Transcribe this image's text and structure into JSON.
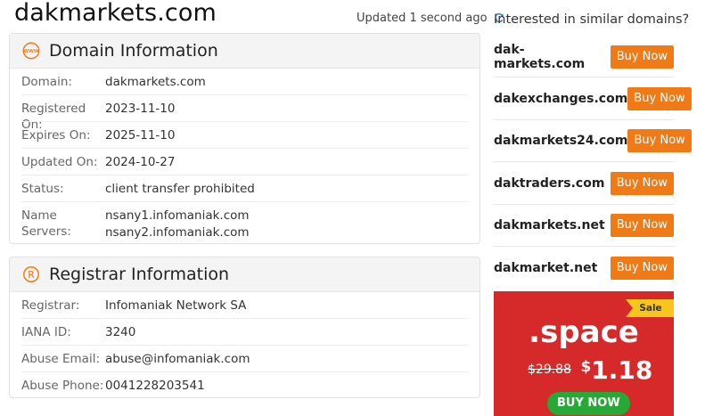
{
  "site": {
    "title": "dakmarkets.com",
    "updated": "Updated 1 second ago"
  },
  "domain_info": {
    "heading": "Domain Information",
    "rows": [
      {
        "label": "Domain:",
        "value": "dakmarkets.com"
      },
      {
        "label": "Registered On:",
        "value": "2023-11-10"
      },
      {
        "label": "Expires On:",
        "value": "2025-11-10"
      },
      {
        "label": "Updated On:",
        "value": "2024-10-27"
      },
      {
        "label": "Status:",
        "value": "client transfer prohibited"
      },
      {
        "label": "Name Servers:",
        "values": [
          "nsany1.infomaniak.com",
          "nsany2.infomaniak.com"
        ]
      }
    ]
  },
  "registrar_info": {
    "heading": "Registrar Information",
    "rows": [
      {
        "label": "Registrar:",
        "value": "Infomaniak Network SA"
      },
      {
        "label": "IANA ID:",
        "value": "3240"
      },
      {
        "label": "Abuse Email:",
        "value": "abuse@infomaniak.com"
      },
      {
        "label": "Abuse Phone:",
        "value": "0041228203541"
      }
    ]
  },
  "similar": {
    "heading": "Interested in similar domains?",
    "button_label": "Buy Now",
    "items": [
      {
        "name": "dak-markets.com"
      },
      {
        "name": "dakexchanges.com"
      },
      {
        "name": "dakmarkets24.com"
      },
      {
        "name": "daktraders.com"
      },
      {
        "name": "dakmarkets.net"
      },
      {
        "name": "dakmarket.net"
      }
    ]
  },
  "promo": {
    "tag": "Sale",
    "extension": ".space",
    "old_price": "$29.88",
    "currency": "$",
    "new_price": "1.18",
    "button_label": "BUY NOW"
  },
  "colors": {
    "accent_orange": "#f07a16",
    "promo_red": "#d62929",
    "sale_yellow": "#f6c61c",
    "buy_green": "#27a937",
    "refresh_blue": "#2a84d6"
  },
  "icons": [
    "refresh-icon",
    "www-icon",
    "registered-icon"
  ]
}
